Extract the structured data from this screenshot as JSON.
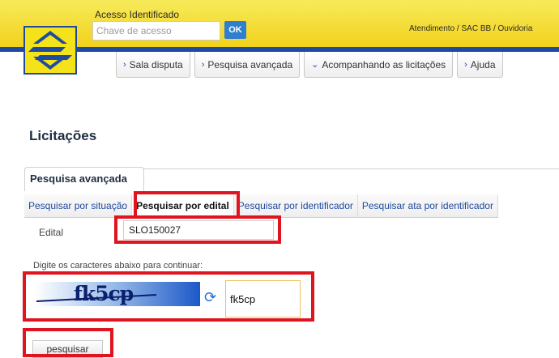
{
  "header": {
    "access_label": "Acesso Identificado",
    "access_placeholder": "Chave de acesso",
    "ok_label": "OK",
    "atendimento_link": "Atendimento / SAC BB / Ouvidoria"
  },
  "menu": {
    "items": [
      {
        "label": "Sala disputa",
        "icon": "chevron-right-icon"
      },
      {
        "label": "Pesquisa avançada",
        "icon": "chevron-right-icon"
      },
      {
        "label": "Acompanhando as licitações",
        "icon": "chevron-down-icon"
      },
      {
        "label": "Ajuda",
        "icon": "chevron-right-icon"
      }
    ]
  },
  "page": {
    "title": "Licitações"
  },
  "section": {
    "title": "Pesquisa avançada"
  },
  "tabs": [
    {
      "label": "Pesquisar por situação"
    },
    {
      "label": "Pesquisar por edital",
      "active": true
    },
    {
      "label": "Pesquisar por identificador"
    },
    {
      "label": "Pesquisar ata por identificador"
    }
  ],
  "form": {
    "edital_label": "Edital",
    "edital_value": "SLO150027",
    "captcha_instruction": "Digite os caracteres abaixo para continuar:",
    "captcha_image_text": "fk5cp",
    "captcha_value": "fk5cp",
    "search_button": "pesquisar"
  },
  "colors": {
    "brand_yellow": "#f4e21a",
    "brand_blue": "#1f4aa0",
    "highlight_red": "#e0141e"
  }
}
